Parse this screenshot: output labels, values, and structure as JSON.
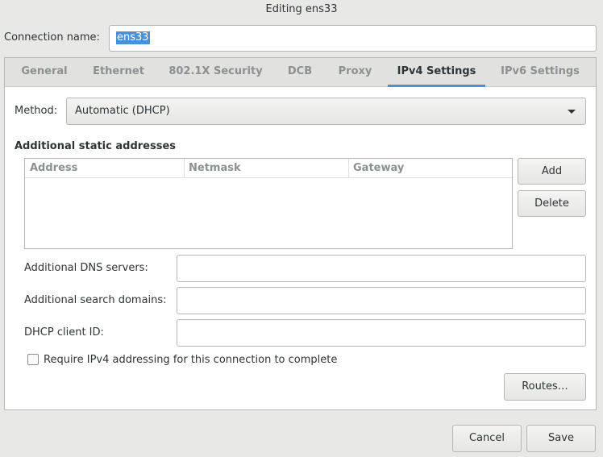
{
  "window": {
    "title": "Editing ens33"
  },
  "connection": {
    "name_label": "Connection name:",
    "name_value": "ens33"
  },
  "tabs": [
    {
      "label": "General"
    },
    {
      "label": "Ethernet"
    },
    {
      "label": "802.1X Security"
    },
    {
      "label": "DCB"
    },
    {
      "label": "Proxy"
    },
    {
      "label": "IPv4 Settings",
      "active": true
    },
    {
      "label": "IPv6 Settings"
    }
  ],
  "ipv4": {
    "method_label": "Method:",
    "method_value": "Automatic (DHCP)",
    "static_heading": "Additional static addresses",
    "columns": [
      "Address",
      "Netmask",
      "Gateway"
    ],
    "add_label": "Add",
    "delete_label": "Delete",
    "dns_label": "Additional DNS servers:",
    "dns_value": "",
    "search_label": "Additional search domains:",
    "search_value": "",
    "dhcp_label": "DHCP client ID:",
    "dhcp_value": "",
    "require_label": "Require IPv4 addressing for this connection to complete",
    "require_checked": false,
    "routes_label": "Routes…"
  },
  "footer": {
    "cancel_label": "Cancel",
    "save_label": "Save"
  },
  "colors": {
    "accent": "#4a90d9",
    "background": "#e8e8e7"
  }
}
